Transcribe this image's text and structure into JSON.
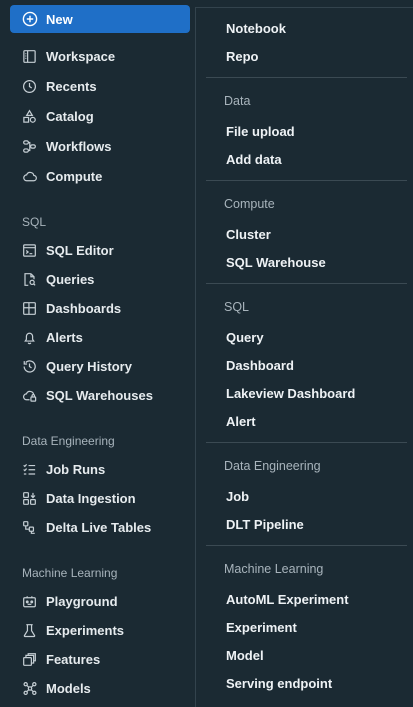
{
  "sidebar": {
    "new_label": "New",
    "items_top": [
      {
        "label": "Workspace",
        "icon": "workspace-icon"
      },
      {
        "label": "Recents",
        "icon": "clock-icon"
      },
      {
        "label": "Catalog",
        "icon": "catalog-icon"
      },
      {
        "label": "Workflows",
        "icon": "workflows-icon"
      },
      {
        "label": "Compute",
        "icon": "cloud-icon"
      }
    ],
    "sql_section": "SQL",
    "sql_items": [
      {
        "label": "SQL Editor",
        "icon": "sql-editor-icon"
      },
      {
        "label": "Queries",
        "icon": "queries-icon"
      },
      {
        "label": "Dashboards",
        "icon": "dashboards-icon"
      },
      {
        "label": "Alerts",
        "icon": "bell-icon"
      },
      {
        "label": "Query History",
        "icon": "history-icon"
      },
      {
        "label": "SQL Warehouses",
        "icon": "warehouse-icon"
      }
    ],
    "de_section": "Data Engineering",
    "de_items": [
      {
        "label": "Job Runs",
        "icon": "job-runs-icon"
      },
      {
        "label": "Data Ingestion",
        "icon": "ingestion-icon"
      },
      {
        "label": "Delta Live Tables",
        "icon": "delta-tables-icon"
      }
    ],
    "ml_section": "Machine Learning",
    "ml_items": [
      {
        "label": "Playground",
        "icon": "playground-icon"
      },
      {
        "label": "Experiments",
        "icon": "flask-icon"
      },
      {
        "label": "Features",
        "icon": "features-icon"
      },
      {
        "label": "Models",
        "icon": "models-icon"
      }
    ]
  },
  "menu": {
    "top_items": [
      "Notebook",
      "Repo"
    ],
    "data_section": "Data",
    "data_items": [
      "File upload",
      "Add data"
    ],
    "compute_section": "Compute",
    "compute_items": [
      "Cluster",
      "SQL Warehouse"
    ],
    "sql_section": "SQL",
    "sql_items": [
      "Query",
      "Dashboard",
      "Lakeview Dashboard",
      "Alert"
    ],
    "de_section": "Data Engineering",
    "de_items": [
      "Job",
      "DLT Pipeline"
    ],
    "ml_section": "Machine Learning",
    "ml_items": [
      "AutoML Experiment",
      "Experiment",
      "Model",
      "Serving endpoint"
    ]
  },
  "colors": {
    "background": "#1b2a33",
    "accent": "#1f6fc7",
    "text": "#e6ebee",
    "muted_text": "#a8b4bc"
  }
}
